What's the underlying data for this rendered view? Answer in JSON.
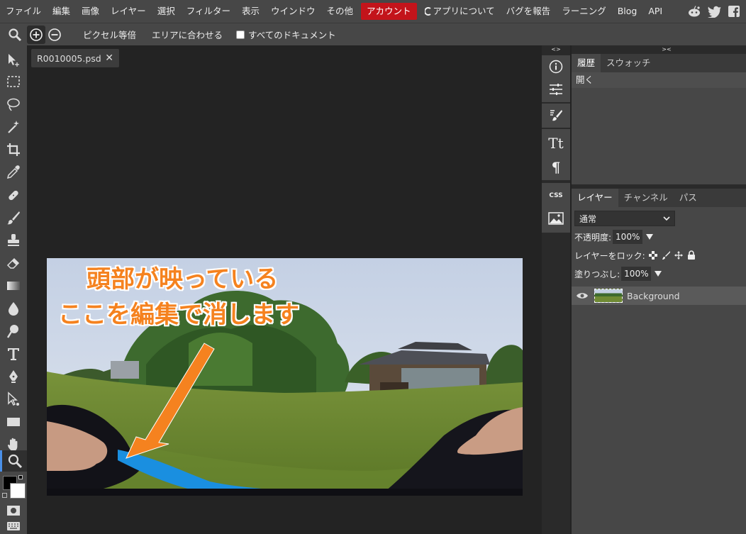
{
  "menubar": {
    "items": [
      "ファイル",
      "編集",
      "画像",
      "レイヤー",
      "選択",
      "フィルター",
      "表示",
      "ウインドウ",
      "その他"
    ],
    "account": "アカウント",
    "about": "アプリについて",
    "report": "バグを報告",
    "learning": "ラーニング",
    "blog": "Blog",
    "api": "API"
  },
  "options": {
    "pixel_equal": "ピクセル等倍",
    "fit_area": "エリアに合わせる",
    "all_documents": "すべてのドキュメント"
  },
  "document": {
    "tab_name": "R0010005.psd",
    "annotation_line1": "頭部が映っている",
    "annotation_line2": "ここを編集で消します"
  },
  "side_strip": {
    "css_label": "CSS",
    "text_label": "Tt",
    "para_label": "¶"
  },
  "history_panel": {
    "tabs": [
      "履歴",
      "スウォッチ"
    ],
    "entries": [
      "開く"
    ]
  },
  "layers_panel": {
    "tabs": [
      "レイヤー",
      "チャンネル",
      "パス"
    ],
    "blend_mode": "通常",
    "opacity_label": "不透明度:",
    "opacity_value": "100%",
    "lock_label": "レイヤーをロック:",
    "fill_label": "塗りつぶし:",
    "fill_value": "100%",
    "layer_name": "Background"
  },
  "colors": {
    "accent": "#c3141b",
    "annotation": "#f5821f",
    "selection_blue": "#1a8fe0"
  }
}
